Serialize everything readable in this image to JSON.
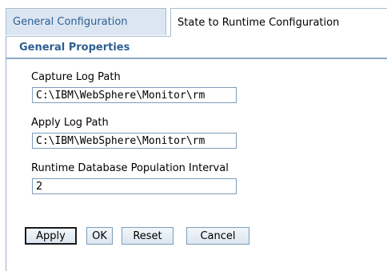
{
  "tabs": [
    {
      "label": "General Configuration",
      "active": false
    },
    {
      "label": "State to Runtime Configuration",
      "active": true
    }
  ],
  "section": {
    "title": "General Properties"
  },
  "fields": {
    "capture_log_path": {
      "label": "Capture Log Path",
      "value": "C:\\IBM\\WebSphere\\Monitor\\rm"
    },
    "apply_log_path": {
      "label": "Apply Log Path",
      "value": "C:\\IBM\\WebSphere\\Monitor\\rm"
    },
    "population_interval": {
      "label": "Runtime Database Population Interval",
      "value": "2"
    }
  },
  "buttons": {
    "apply": "Apply",
    "ok": "OK",
    "reset": "Reset",
    "cancel": "Cancel"
  },
  "colors": {
    "tab_inactive_bg": "#dbe6f2",
    "accent_text": "#2e5f93",
    "border": "#a8bcd0",
    "input_border": "#7f9db9"
  }
}
